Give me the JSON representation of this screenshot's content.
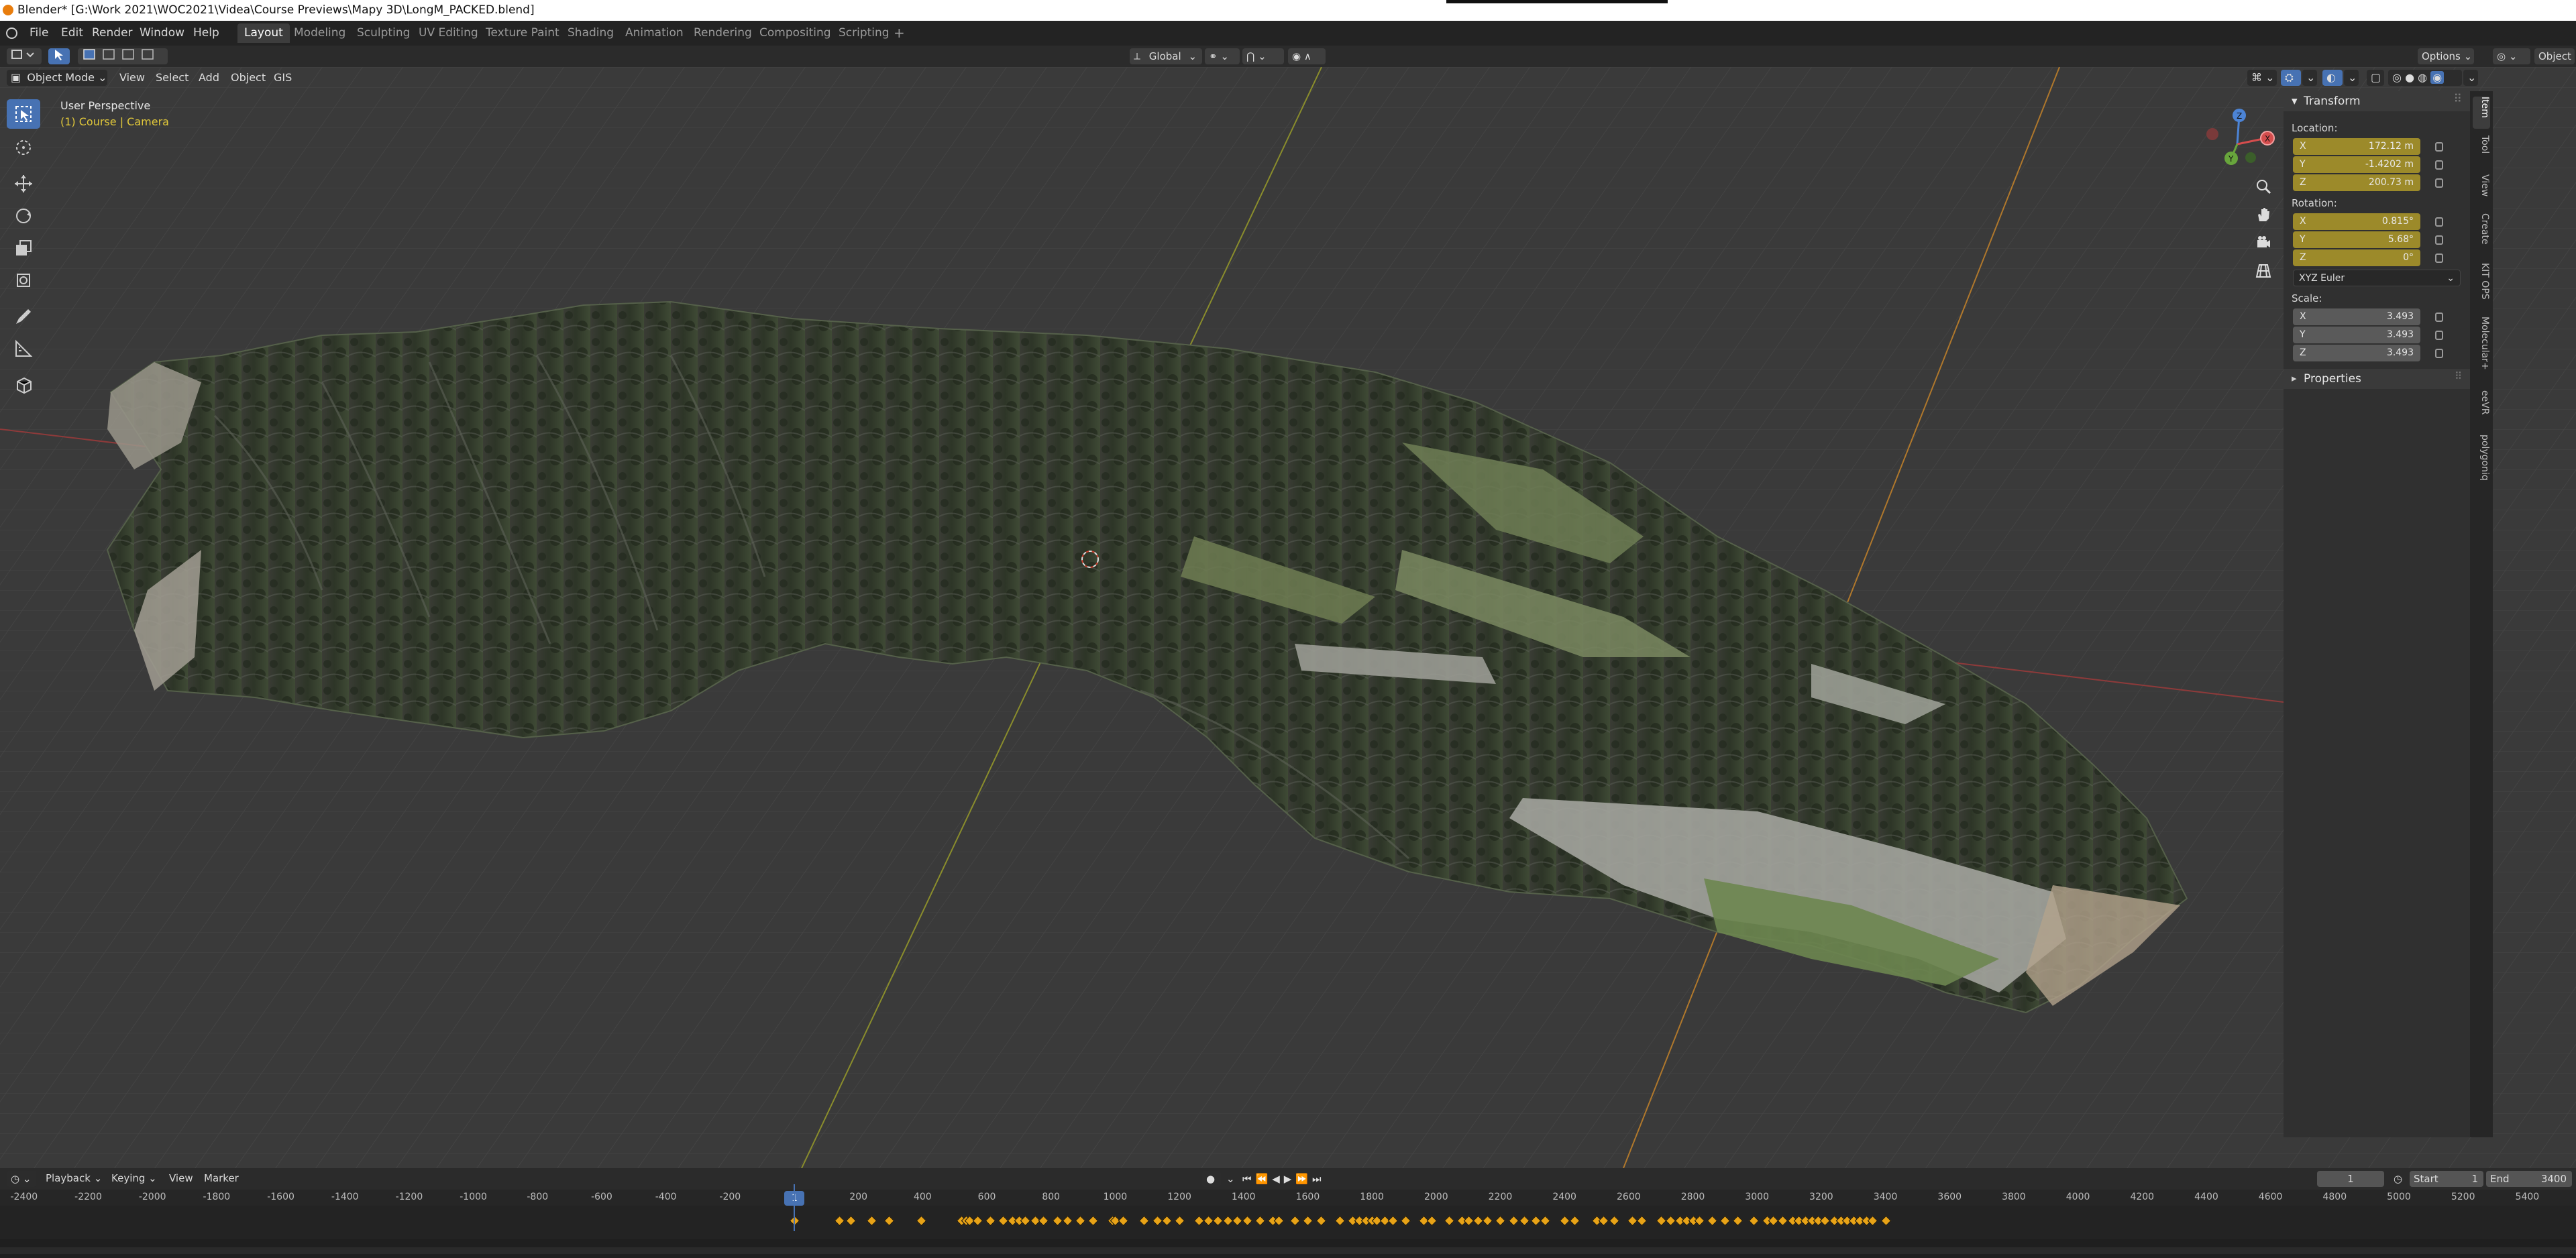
{
  "window": {
    "title": "Blender* [G:\\Work 2021\\WOC2021\\Videa\\Course Previews\\Mapy 3D\\LongM_PACKED.blend]"
  },
  "menubar": {
    "menus": [
      "File",
      "Edit",
      "Render",
      "Window",
      "Help"
    ],
    "workspaces": [
      {
        "label": "Layout",
        "active": true
      },
      {
        "label": "Modeling"
      },
      {
        "label": "Sculpting"
      },
      {
        "label": "UV Editing"
      },
      {
        "label": "Texture Paint"
      },
      {
        "label": "Shading"
      },
      {
        "label": "Animation"
      },
      {
        "label": "Rendering"
      },
      {
        "label": "Compositing"
      },
      {
        "label": "Scripting"
      }
    ]
  },
  "toolbar": {
    "transform_orientation": "Global",
    "options_label": "Options"
  },
  "viewport_header": {
    "mode": "Object Mode",
    "menus": [
      "View",
      "Select",
      "Add",
      "Object",
      "GIS"
    ],
    "right_label": "Object"
  },
  "viewport": {
    "perspective_label": "User Perspective",
    "active_object": "(1) Course | Camera",
    "accent_text_color": "#e0c73a"
  },
  "npanel": {
    "section": "Transform",
    "location": {
      "label": "Location:",
      "x": "172.12 m",
      "y": "-1.4202 m",
      "z": "200.73 m"
    },
    "rotation": {
      "label": "Rotation:",
      "x": "0.815°",
      "y": "5.68°",
      "z": "0°"
    },
    "rotation_mode": "XYZ Euler",
    "scale": {
      "label": "Scale:",
      "x": "3.493",
      "y": "3.493",
      "z": "3.493"
    },
    "axis_labels": [
      "X",
      "Y",
      "Z"
    ],
    "properties_label": "Properties",
    "tabs": [
      "Item",
      "Tool",
      "View",
      "Create",
      "KIT OPS",
      "Molecular+",
      "eeVR",
      "polygoniq"
    ]
  },
  "timeline": {
    "menus": [
      "Playback",
      "Keying",
      "View",
      "Marker"
    ],
    "current_frame": "1",
    "start_label": "Start",
    "start_value": "1",
    "end_label": "End",
    "end_value": "3400",
    "ruler": [
      "-2400",
      "-2200",
      "-2000",
      "-1800",
      "-1600",
      "-1400",
      "-1200",
      "-1000",
      "-800",
      "-600",
      "-400",
      "-200",
      "200",
      "400",
      "600",
      "800",
      "1000",
      "1200",
      "1400",
      "1600",
      "1800",
      "2000",
      "2200",
      "2400",
      "2600",
      "2800",
      "3000",
      "3200",
      "3400",
      "3600",
      "3800",
      "4000",
      "4200",
      "4400",
      "4600",
      "4800",
      "5000",
      "5200",
      "5400"
    ],
    "keyframes": [
      1,
      140,
      175,
      240,
      295,
      395,
      520,
      535,
      545,
      570,
      610,
      650,
      680,
      700,
      720,
      750,
      775,
      820,
      850,
      890,
      930,
      990,
      1000,
      1025,
      1090,
      1130,
      1160,
      1200,
      1260,
      1290,
      1320,
      1350,
      1380,
      1410,
      1450,
      1490,
      1510,
      1560,
      1600,
      1640,
      1700,
      1740,
      1760,
      1780,
      1800,
      1815,
      1840,
      1865,
      1905,
      1960,
      1985,
      2040,
      2080,
      2100,
      2130,
      2160,
      2200,
      2240,
      2275,
      2310,
      2340,
      2400,
      2430,
      2500,
      2520,
      2555,
      2610,
      2640,
      2700,
      2730,
      2760,
      2780,
      2800,
      2820,
      2860,
      2900,
      2940,
      2990,
      3030,
      3050,
      3080,
      3110,
      3130,
      3150,
      3170,
      3190,
      3210,
      3240,
      3260,
      3280,
      3300,
      3320,
      3340,
      3360,
      3400
    ]
  }
}
